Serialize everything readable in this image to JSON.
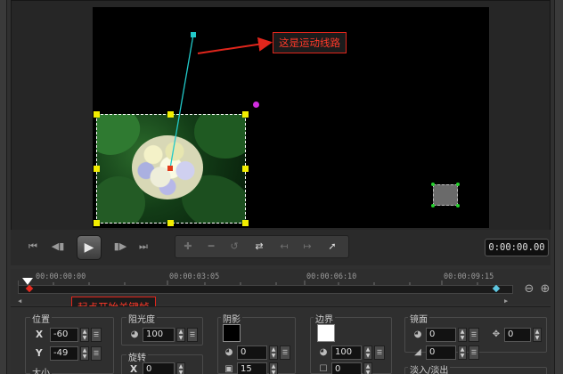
{
  "colors": {
    "preview_bg": "#000000",
    "selection_handle": "#f2ee00",
    "motion_path": "#21c9c9",
    "callout_border": "#e1261c",
    "callout_text": "#ff3a2a",
    "keyframe_start": "#e52a1f",
    "keyframe_end": "#5ec6e0",
    "shadow_swatch": "#000000",
    "border_swatch": "#ffffff"
  },
  "annotations": {
    "motion_path": "这是运动线路",
    "start_keyframe": "起点开始关键帧"
  },
  "transport": {
    "icons": [
      "skip-start-icon",
      "step-back-icon",
      "play-icon",
      "step-forward-icon",
      "skip-end-icon"
    ],
    "timecode": "0:00:00.00"
  },
  "keyframe_tools": {
    "icons": [
      "add-keyframe-icon",
      "remove-keyframe-icon",
      "reverse-keyframe-icon",
      "swap-keyframe-icon",
      "prev-keyframe-icon",
      "next-keyframe-icon",
      "smooth-path-icon"
    ]
  },
  "timeline": {
    "ticks": [
      "00:00:00:00",
      "00:00:03:05",
      "00:00:06:10",
      "00:00:09:15"
    ],
    "zoom_icons": [
      "zoom-out-icon",
      "zoom-in-icon"
    ]
  },
  "properties": {
    "position": {
      "label": "位置",
      "x_label": "X",
      "x_value": "-60",
      "y_label": "Y",
      "y_value": "-49",
      "size_label": "大小"
    },
    "opacity": {
      "label": "阻光度",
      "value": "100"
    },
    "rotation": {
      "label": "旋转",
      "x_label": "X",
      "x_value": "0"
    },
    "shadow": {
      "label": "阴影",
      "value1": "0",
      "value2": "15"
    },
    "border": {
      "label": "边界",
      "value1": "100",
      "value2": "0"
    },
    "mirror": {
      "label": "镜面",
      "value1": "0",
      "value2": "0",
      "value3": "0"
    },
    "fade": {
      "label": "淡入/淡出"
    }
  }
}
